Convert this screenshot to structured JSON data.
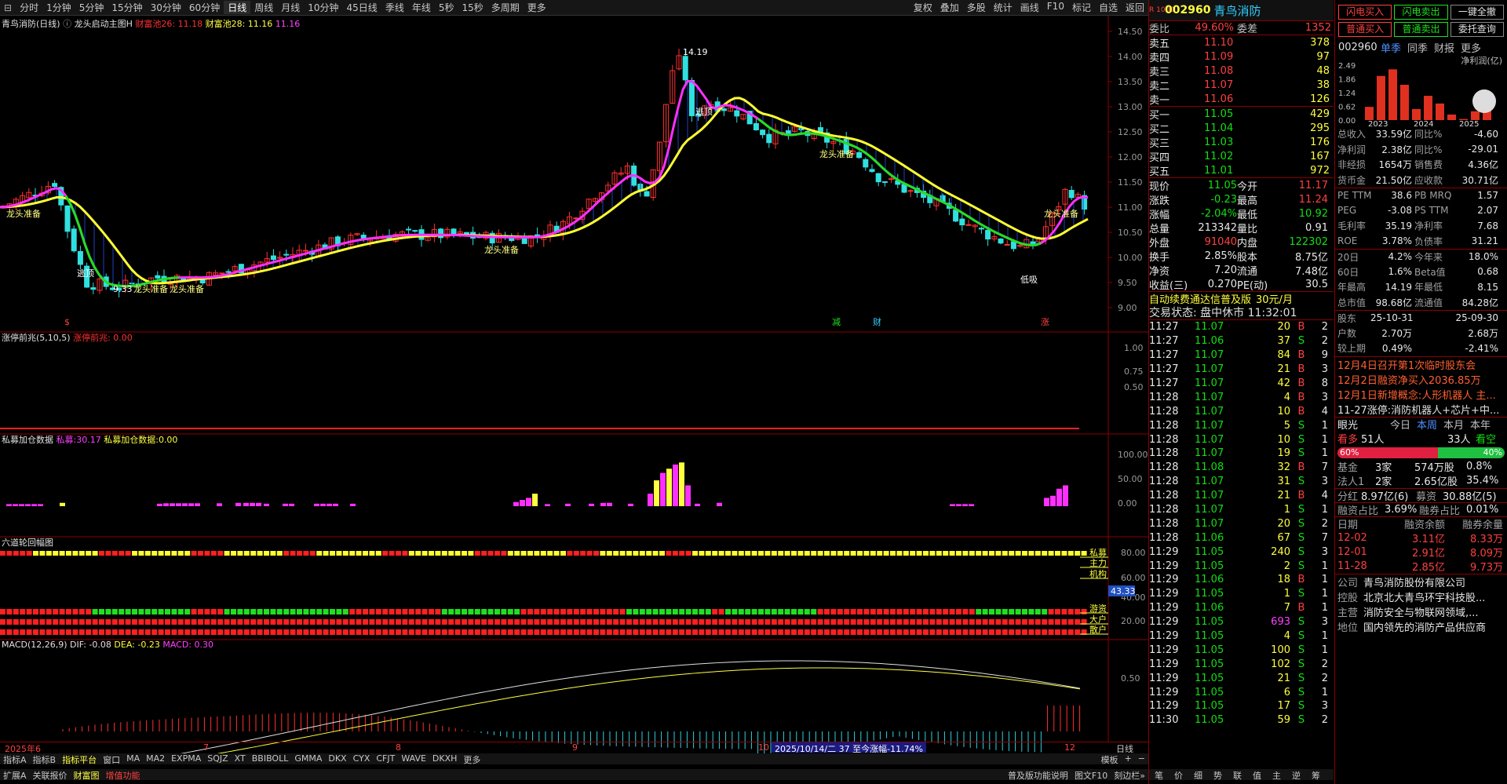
{
  "toolbar": {
    "periods": [
      "分时",
      "1分钟",
      "5分钟",
      "15分钟",
      "30分钟",
      "60分钟",
      "日线",
      "周线",
      "月线",
      "10分钟",
      "45日线",
      "季线",
      "年线",
      "5秒",
      "15秒",
      "多周期",
      "更多"
    ],
    "active": "日线",
    "right": [
      "复权",
      "叠加",
      "多股",
      "统计",
      "画线",
      "F10",
      "标记",
      "自选",
      "返回"
    ]
  },
  "main": {
    "title": "青鸟消防(日线)",
    "indicator": "龙头启动主图H",
    "v1": "财富池26: 11.18",
    "v2": "财富池28: 11.16",
    "v3": "11.16",
    "yticks": [
      "14.50",
      "14.00",
      "13.50",
      "13.00",
      "12.50",
      "12.00",
      "11.50",
      "11.00",
      "10.50",
      "10.00",
      "9.50",
      "9.00"
    ],
    "yvals": [
      14.5,
      14.0,
      13.5,
      13.0,
      12.5,
      12.0,
      11.5,
      11.0,
      10.5,
      10.0,
      9.5,
      9.0
    ],
    "annotations": {
      "high": "14.19",
      "low": "9.33",
      "escape": "逃顶",
      "escape2": "逃顶",
      "dragon": "龙头准备",
      "lowlevel": "低吸"
    },
    "marks": [
      "$",
      "减",
      "财",
      "涨"
    ]
  },
  "ztqz": {
    "title": "涨停前兆(5,10,5)",
    "label": "涨停前兆:",
    "value": "0.00",
    "yticks": [
      "1.00",
      "0.75",
      "0.50"
    ]
  },
  "smjc": {
    "title": "私募加仓数据",
    "l1": "私募:",
    "v1": "30.17",
    "l2": "私募加仓数据:",
    "v2": "0.00",
    "yticks": [
      "100.00",
      "50.00",
      "0.00"
    ]
  },
  "six": {
    "title": "六道轮回幅图",
    "labels": [
      "私募",
      "主力",
      "机构",
      "游资",
      "大户",
      "散户"
    ],
    "yticks": [
      "80.00",
      "60.00",
      "40.00",
      "20.00"
    ],
    "cursor": "43.33"
  },
  "macd": {
    "title": "MACD(12,26,9)",
    "dif": "DIF: -0.08",
    "dea": "DEA: -0.23",
    "macd": "MACD: 0.30",
    "ytick": "0.50"
  },
  "xaxis": {
    "labels": [
      "2025年6",
      "7",
      "8",
      "9",
      "10",
      "12"
    ],
    "tooltip": "2025/10/14/二 37 至今涨幅-11.74%",
    "period": "日线"
  },
  "bottom1": [
    "指标A",
    "指标B",
    "指标平台",
    "窗口",
    "MA",
    "MA2",
    "EXPMA",
    "SQJZ",
    "XT",
    "BBIBOLL",
    "GMMA",
    "DKX",
    "CYX",
    "CFJT",
    "WAVE",
    "DKXH",
    "更多"
  ],
  "bottom2": [
    "扩展A",
    "关联报价",
    "财富图",
    "增值功能"
  ],
  "bottomright": [
    "模板",
    "+",
    "−"
  ],
  "bottom2right": [
    "普及版功能说明",
    "图文F10",
    "刻边栏»"
  ],
  "quote": {
    "code": "002960",
    "name": "青鸟消防",
    "tag": "R 1000",
    "weibi_label": "委比",
    "weibi": "49.60%",
    "weicha_label": "委差",
    "weicha": "1352",
    "sells": [
      [
        "卖五",
        "11.10",
        "378"
      ],
      [
        "卖四",
        "11.09",
        "97"
      ],
      [
        "卖三",
        "11.08",
        "48"
      ],
      [
        "卖二",
        "11.07",
        "38"
      ],
      [
        "卖一",
        "11.06",
        "126"
      ]
    ],
    "buys": [
      [
        "买一",
        "11.05",
        "429"
      ],
      [
        "买二",
        "11.04",
        "295"
      ],
      [
        "买三",
        "11.03",
        "176"
      ],
      [
        "买四",
        "11.02",
        "167"
      ],
      [
        "买五",
        "11.01",
        "972"
      ]
    ],
    "stats": [
      [
        "现价",
        "11.05",
        "今开",
        "11.17"
      ],
      [
        "涨跌",
        "-0.23",
        "最高",
        "11.24"
      ],
      [
        "涨幅",
        "-2.04%",
        "最低",
        "10.92"
      ],
      [
        "总量",
        "213342",
        "量比",
        "0.91"
      ],
      [
        "外盘",
        "91040",
        "内盘",
        "122302"
      ],
      [
        "换手",
        "2.85%",
        "股本",
        "8.75亿"
      ],
      [
        "净资",
        "7.20",
        "流通",
        "7.48亿"
      ],
      [
        "收益(三)",
        "0.270",
        "PE(动)",
        "30.5"
      ]
    ],
    "ad1": "自动续费通达信普及版",
    "ad2": "30元/月",
    "status": "交易状态: 盘中休市 11:32:01",
    "ticks": [
      [
        "11:27",
        "11.07",
        "20",
        "B",
        "2"
      ],
      [
        "11:27",
        "11.06",
        "37",
        "S",
        "2"
      ],
      [
        "11:27",
        "11.07",
        "84",
        "B",
        "9"
      ],
      [
        "11:27",
        "11.07",
        "21",
        "B",
        "3"
      ],
      [
        "11:27",
        "11.07",
        "42",
        "B",
        "8"
      ],
      [
        "11:28",
        "11.07",
        "4",
        "B",
        "3"
      ],
      [
        "11:28",
        "11.07",
        "10",
        "B",
        "4"
      ],
      [
        "11:28",
        "11.07",
        "5",
        "S",
        "1"
      ],
      [
        "11:28",
        "11.07",
        "10",
        "S",
        "1"
      ],
      [
        "11:28",
        "11.07",
        "19",
        "S",
        "1"
      ],
      [
        "11:28",
        "11.08",
        "32",
        "B",
        "7"
      ],
      [
        "11:28",
        "11.07",
        "31",
        "S",
        "3"
      ],
      [
        "11:28",
        "11.07",
        "21",
        "B",
        "4"
      ],
      [
        "11:28",
        "11.07",
        "1",
        "S",
        "1"
      ],
      [
        "11:28",
        "11.07",
        "20",
        "S",
        "2"
      ],
      [
        "11:28",
        "11.06",
        "67",
        "S",
        "7"
      ],
      [
        "11:29",
        "11.05",
        "240",
        "S",
        "3"
      ],
      [
        "11:29",
        "11.05",
        "2",
        "S",
        "1"
      ],
      [
        "11:29",
        "11.06",
        "18",
        "B",
        "1"
      ],
      [
        "11:29",
        "11.05",
        "1",
        "S",
        "1"
      ],
      [
        "11:29",
        "11.06",
        "7",
        "B",
        "1"
      ],
      [
        "11:29",
        "11.05",
        "693",
        "S",
        "3"
      ],
      [
        "11:29",
        "11.05",
        "4",
        "S",
        "1"
      ],
      [
        "11:29",
        "11.05",
        "100",
        "S",
        "1"
      ],
      [
        "11:29",
        "11.05",
        "102",
        "S",
        "2"
      ],
      [
        "11:29",
        "11.05",
        "21",
        "S",
        "2"
      ],
      [
        "11:29",
        "11.05",
        "6",
        "S",
        "1"
      ],
      [
        "11:29",
        "11.05",
        "17",
        "S",
        "3"
      ],
      [
        "11:30",
        "11.05",
        "59",
        "S",
        "2"
      ]
    ],
    "tabs": [
      "笔",
      "价",
      "细",
      "势",
      "联",
      "值",
      "主",
      "逆",
      "筹"
    ]
  },
  "fin": {
    "btns": [
      "闪电买入",
      "闪电卖出",
      "一键全撤",
      "普通买入",
      "普通卖出",
      "委托查询"
    ],
    "code": "002960",
    "tabs": [
      "单季",
      "同季",
      "财报",
      "更多"
    ],
    "chart_label": "净利润(亿)",
    "chart_yticks": [
      "2.49",
      "1.86",
      "1.24",
      "0.62",
      "0.00"
    ],
    "years": [
      "2023",
      "2024",
      "2025"
    ],
    "chart_data": {
      "type": "bar",
      "categories": [
        "2023Q1",
        "2023Q2",
        "2023Q3",
        "2023Q4",
        "2024Q1",
        "2024Q2",
        "2024Q3",
        "2024Q4",
        "2025Q1",
        "2025Q2",
        "2025Q3"
      ],
      "values": [
        0.6,
        2.0,
        2.3,
        1.6,
        0.5,
        1.1,
        0.75,
        0.25,
        0.05,
        0.4,
        0.6
      ],
      "ylim": [
        0,
        2.49
      ]
    },
    "rows": [
      [
        "总收入",
        "33.59亿",
        "同比%",
        "-4.60"
      ],
      [
        "净利润",
        "2.38亿",
        "同比%",
        "-29.01"
      ],
      [
        "非经损",
        "1654万",
        "销售费",
        "4.36亿"
      ],
      [
        "货币金",
        "21.50亿",
        "应收款",
        "30.71亿"
      ],
      [
        "PE TTM",
        "38.6",
        "PB MRQ",
        "1.57"
      ],
      [
        "PEG",
        "-3.08",
        "PS TTM",
        "2.07"
      ],
      [
        "毛利率",
        "35.19",
        "净利率",
        "7.68"
      ],
      [
        "ROE",
        "3.78%",
        "负债率",
        "31.21"
      ],
      [
        "20日",
        "4.2%",
        "今年来",
        "18.0%"
      ],
      [
        "60日",
        "1.6%",
        "Beta值",
        "0.68"
      ],
      [
        "年最高",
        "14.19",
        "年最低",
        "8.15"
      ],
      [
        "总市值",
        "98.68亿",
        "流通值",
        "84.28亿"
      ],
      [
        "股东",
        "25-10-31",
        "",
        "25-09-30"
      ],
      [
        "户数",
        "2.70万",
        "",
        "2.68万"
      ],
      [
        "较上期",
        "0.49%",
        "",
        "-2.41%"
      ]
    ],
    "news": [
      "12月4日召开第1次临时股东会",
      "12月2日融资净买入2036.85万",
      "12月1日新增概念:人形机器人 主...",
      "11-27涨停:消防机器人+芯片+中..."
    ],
    "eye": {
      "label": "眼光",
      "tabs": [
        "今日",
        "本周",
        "本月",
        "本年"
      ],
      "bull": "看多",
      "bull_n": "51人",
      "bear_n": "33人",
      "bear": "看空",
      "bull_pct": "60%",
      "bear_pct": "40%"
    },
    "fund": [
      [
        "基金",
        "3家",
        "574万股",
        "0.8%"
      ],
      [
        "法人1",
        "2家",
        "2.65亿股",
        "35.4%"
      ]
    ],
    "fenhong": [
      "分红",
      "8.97亿(6)",
      "募资",
      "30.88亿(5)"
    ],
    "rzzb": [
      "融资占比",
      "3.69%",
      "融券占比",
      "0.01%"
    ],
    "rz_head": [
      "日期",
      "融资余额",
      "融券余量"
    ],
    "rz": [
      [
        "12-02",
        "3.11亿",
        "8.33万"
      ],
      [
        "12-01",
        "2.91亿",
        "8.09万"
      ],
      [
        "11-28",
        "2.85亿",
        "9.73万"
      ]
    ],
    "company": [
      [
        "公司",
        "青鸟消防股份有限公司"
      ],
      [
        "控股",
        "北京北大青鸟环宇科技股..."
      ],
      [
        "主营",
        "消防安全与物联网领域,..."
      ],
      [
        "地位",
        "国内领先的消防产品供应商"
      ]
    ]
  }
}
